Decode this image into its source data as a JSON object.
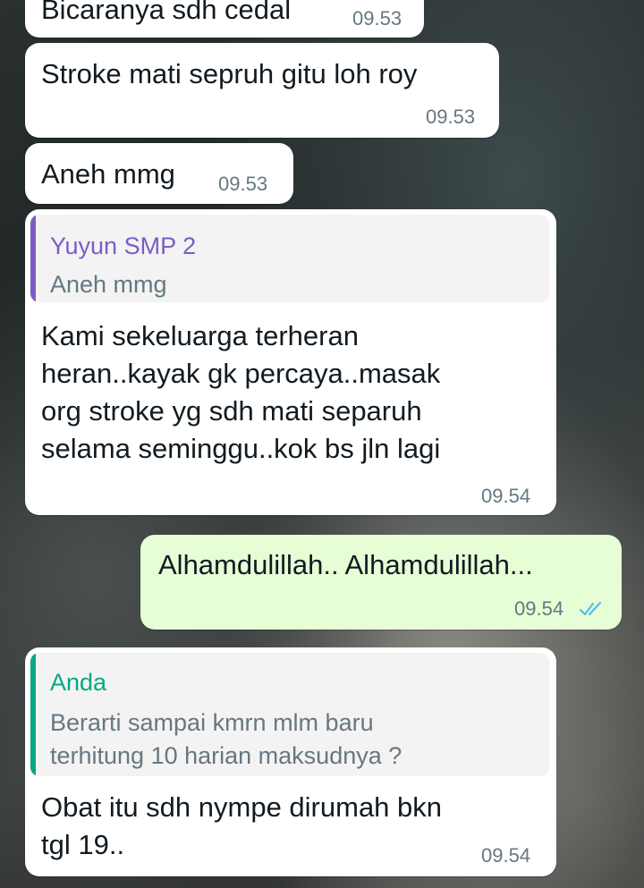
{
  "messages": [
    {
      "text": "Bicaranya sdh cedal",
      "time": "09.53"
    },
    {
      "text": "Stroke mati sepruh gitu loh roy",
      "time": "09.53"
    },
    {
      "text": "Aneh mmg",
      "time": "09.53"
    },
    {
      "quote": {
        "author": "Yuyun SMP 2",
        "author_color": "#7b5cc6",
        "text": "Aneh mmg"
      },
      "lines": [
        "Kami sekeluarga terheran",
        "heran..kayak gk percaya..masak",
        "org stroke yg sdh mati separuh",
        "selama seminggu..kok bs jln lagi"
      ],
      "time": "09.54"
    },
    {
      "text": "Alhamdulillah.. Alhamdulillah...",
      "time": "09.54",
      "status": "read-ticks-icon",
      "tick_color": "#53bdeb"
    },
    {
      "quote": {
        "author": "Anda",
        "author_color": "#06a884",
        "lines": [
          "Berarti sampai kmrn mlm baru",
          "terhitung 10 harian maksudnya ?"
        ]
      },
      "lines": [
        "Obat itu sdh nympe dirumah bkn",
        "tgl 19.."
      ],
      "time": "09.54"
    }
  ]
}
